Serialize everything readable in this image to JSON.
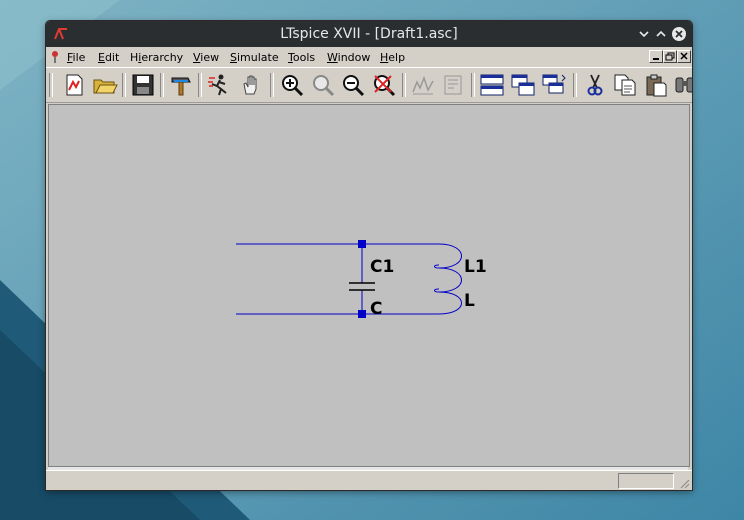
{
  "window": {
    "title": "LTspice XVII - [Draft1.asc]"
  },
  "menu": {
    "items": [
      {
        "pre": "",
        "u": "F",
        "post": "ile"
      },
      {
        "pre": "",
        "u": "E",
        "post": "dit"
      },
      {
        "pre": "H",
        "u": "i",
        "post": "erarchy"
      },
      {
        "pre": "",
        "u": "V",
        "post": "iew"
      },
      {
        "pre": "",
        "u": "S",
        "post": "imulate"
      },
      {
        "pre": "",
        "u": "T",
        "post": "ools"
      },
      {
        "pre": "",
        "u": "W",
        "post": "indow"
      },
      {
        "pre": "",
        "u": "H",
        "post": "elp"
      }
    ]
  },
  "toolbar": {
    "tools": [
      "new-schematic",
      "open",
      "save",
      "control-panel",
      "run",
      "halt",
      "zoom-in",
      "pan",
      "zoom-out",
      "zoom-fit",
      "autorange",
      "view-netlist",
      "tile-horizontal",
      "tile-vertical",
      "cascade",
      "cut",
      "copy",
      "paste",
      "find"
    ]
  },
  "schematic": {
    "components": [
      {
        "ref": "C1",
        "value": "C"
      },
      {
        "ref": "L1",
        "value": "L"
      }
    ]
  },
  "colors": {
    "wire": "#0000c8",
    "canvas": "#c0c0c0"
  }
}
